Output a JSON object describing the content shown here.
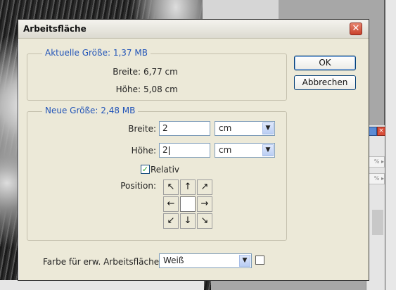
{
  "dialog": {
    "title": "Arbeitsfläche",
    "close_glyph": "✕",
    "current_size": {
      "legend": "Aktuelle Größe: 1,37 MB",
      "width_label": "Breite:",
      "width_value": "6,77 cm",
      "height_label": "Höhe:",
      "height_value": "5,08 cm"
    },
    "new_size": {
      "legend": "Neue Größe: 2,48 MB",
      "width_label": "Breite:",
      "width_value": "2",
      "width_unit": "cm",
      "height_label": "Höhe:",
      "height_value": "2",
      "height_unit": "cm",
      "relative_label": "Relativ",
      "relative_checked": true,
      "position_label": "Position:",
      "anchor_arrows": [
        "↖",
        "↑",
        "↗",
        "←",
        "",
        "→",
        "↙",
        "↓",
        "↘"
      ]
    },
    "canvas_color_label": "Farbe für erw. Arbeitsfläche:",
    "canvas_color_value": "Weiß",
    "ok_label": "OK",
    "cancel_label": "Abbrechen",
    "dropdown_arrow": "▼",
    "check_glyph": "✓"
  },
  "side_panel": {
    "row_texts": [
      "%  ▸",
      "%  ▸"
    ],
    "close_glyph": "×",
    "menu_glyph": "▸"
  }
}
